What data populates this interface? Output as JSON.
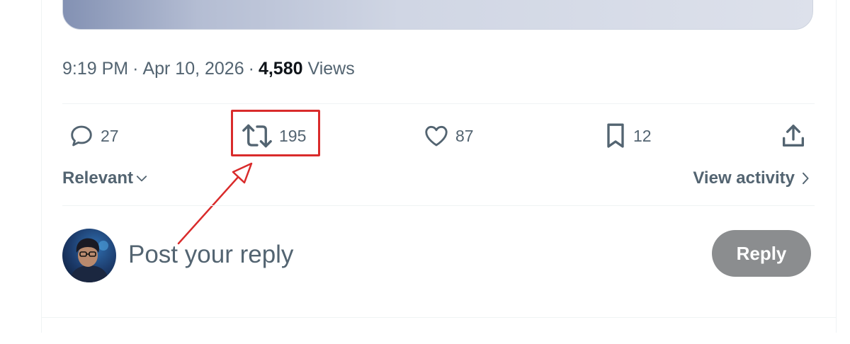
{
  "post": {
    "time": "9:19 PM",
    "dot_1": "·",
    "date": "Apr 10, 2026",
    "dot_2": "·",
    "views_count": "4,580",
    "views_label": "Views"
  },
  "actions": {
    "replies": {
      "icon": "comment-icon",
      "count": "27"
    },
    "reposts": {
      "icon": "repost-icon",
      "count": "195"
    },
    "likes": {
      "icon": "heart-icon",
      "count": "87"
    },
    "bookmarks": {
      "icon": "bookmark-icon",
      "count": "12"
    },
    "share": {
      "icon": "share-icon"
    }
  },
  "replies_bar": {
    "sort_label": "Relevant",
    "sort_icon": "chevron-down-icon",
    "activity_label": "View activity",
    "activity_icon": "chevron-right-icon"
  },
  "composer": {
    "placeholder": "Post your reply",
    "value": "",
    "button_label": "Reply"
  },
  "annotation": {
    "color": "#d92b2b",
    "target": "repost count"
  },
  "colors": {
    "text_secondary": "#536471",
    "text_primary": "#0f1419",
    "reply_button_disabled": "#8b8d8f",
    "divider": "#eff3f4"
  }
}
